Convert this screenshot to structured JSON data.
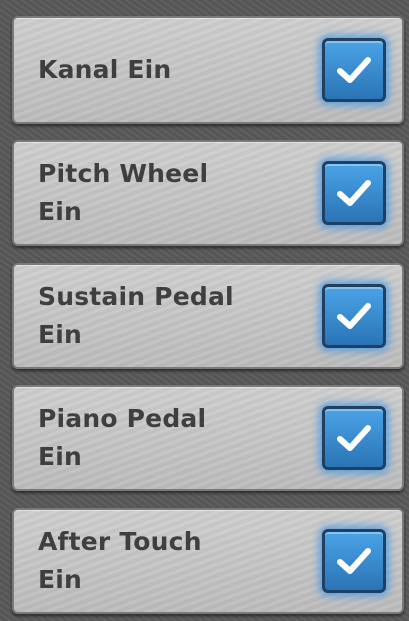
{
  "settings": {
    "items": [
      {
        "label": "Kanal Ein",
        "checked": true,
        "icon": "checkmark-icon"
      },
      {
        "label": "Pitch Wheel\nEin",
        "checked": true,
        "icon": "checkmark-icon"
      },
      {
        "label": "Sustain Pedal\nEin",
        "checked": true,
        "icon": "checkmark-icon"
      },
      {
        "label": "Piano Pedal\nEin",
        "checked": true,
        "icon": "checkmark-icon"
      },
      {
        "label": "After Touch\nEin",
        "checked": true,
        "icon": "checkmark-icon"
      }
    ]
  },
  "colors": {
    "accent": "#2f7fc4",
    "row_background": "#c4c4c4",
    "text": "#3f3f3f"
  }
}
